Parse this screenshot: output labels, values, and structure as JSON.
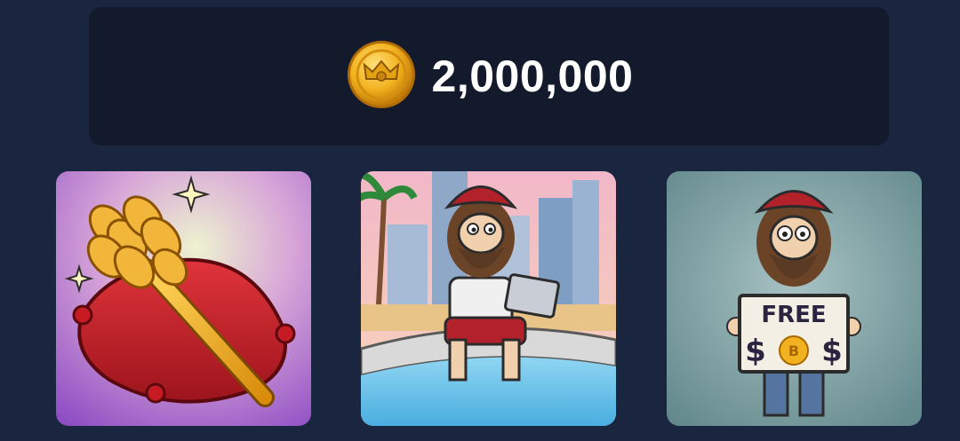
{
  "balance": {
    "amount": "2,000,000",
    "icon": "gold-crown-coin-icon"
  },
  "items": [
    {
      "id": "toilet-brush-pillow",
      "icon": "toilet-brush-on-pillow-image"
    },
    {
      "id": "hobo-laptop-fountain",
      "icon": "hobo-with-laptop-at-fountain-image"
    },
    {
      "id": "hobo-free-sign",
      "icon": "hobo-holding-free-coin-sign-image",
      "sign_line1": "FREE",
      "sign_line2_left": "$",
      "sign_line2_right": "$",
      "sign_coin": "B"
    }
  ],
  "colors": {
    "background": "#1a2540",
    "panel": "#121a2b",
    "coin": "#f2b21f",
    "text": "#ffffff"
  }
}
